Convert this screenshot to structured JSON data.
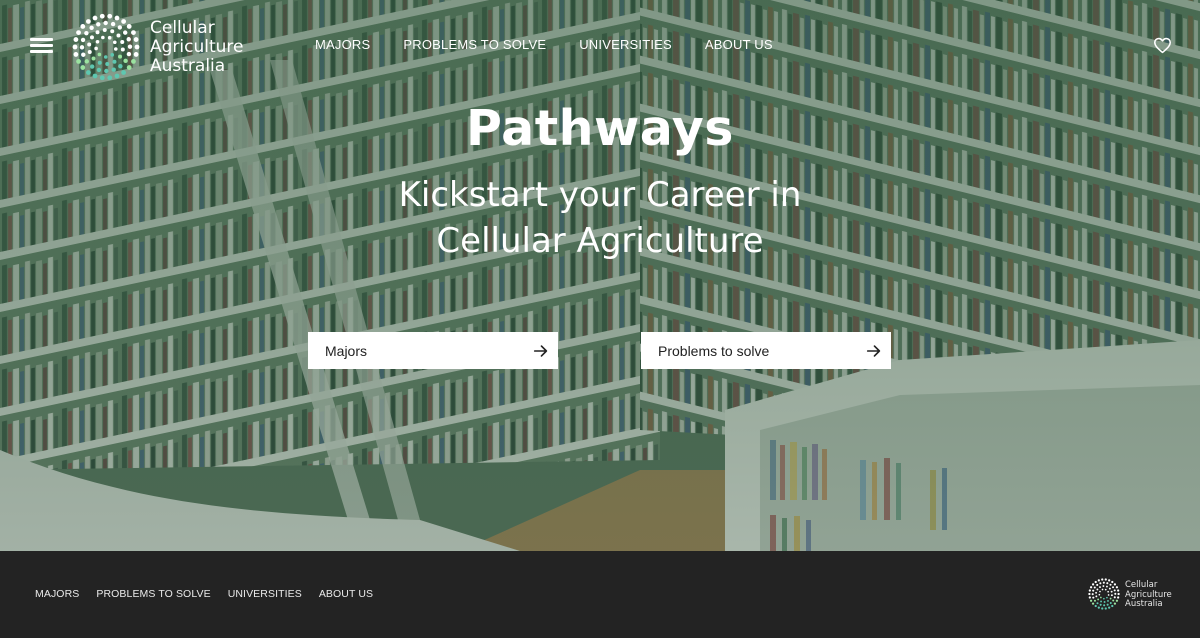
{
  "header": {
    "logo_lines": [
      "Cellular",
      "Agriculture",
      "Australia"
    ],
    "nav": [
      {
        "label": "MAJORS"
      },
      {
        "label": "PROBLEMS TO SOLVE"
      },
      {
        "label": "UNIVERSITIES"
      },
      {
        "label": "ABOUT US"
      }
    ],
    "icons": {
      "menu": "hamburger-menu-icon",
      "favorite": "heart-icon"
    }
  },
  "hero": {
    "title": "Pathways",
    "subtitle_lines": [
      "Kickstart your Career in",
      "Cellular Agriculture"
    ],
    "buttons": [
      {
        "label": "Majors",
        "icon": "arrow-right-icon"
      },
      {
        "label": "Problems to solve",
        "icon": "arrow-right-icon"
      }
    ],
    "background": "library bookshelves photo with green overlay"
  },
  "footer": {
    "nav": [
      {
        "label": "MAJORS"
      },
      {
        "label": "PROBLEMS TO SOLVE"
      },
      {
        "label": "UNIVERSITIES"
      },
      {
        "label": "ABOUT US"
      }
    ],
    "logo_lines": [
      "Cellular",
      "Agriculture",
      "Australia"
    ]
  },
  "colors": {
    "overlay": "#3c5a45",
    "footer_bg": "#232323",
    "button_bg": "#ffffff",
    "logo_dot_light": "#ffffff",
    "logo_dot_green": "#9be3a0",
    "logo_dot_teal": "#5ec7b0"
  }
}
